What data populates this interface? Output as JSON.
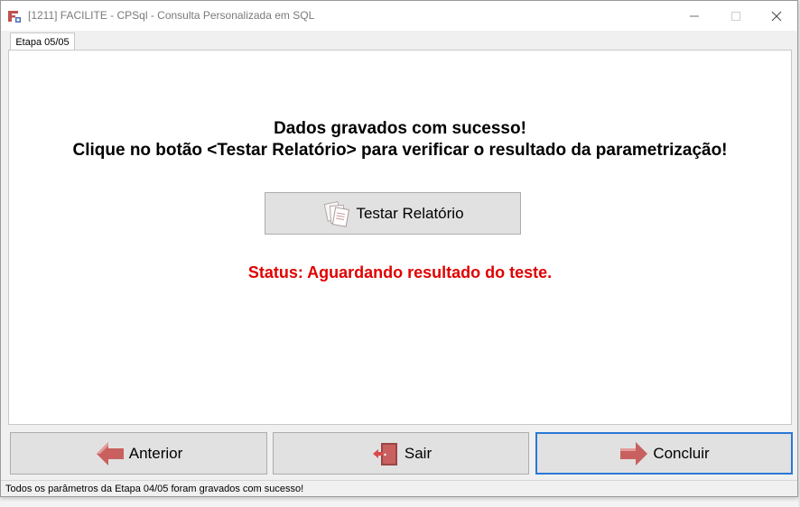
{
  "window": {
    "title": "[1211] FACILITE - CPSql - Consulta Personalizada em SQL"
  },
  "tabs": [
    {
      "label": "Etapa 05/05"
    }
  ],
  "main": {
    "message_line1": "Dados gravados com sucesso!",
    "message_line2": "Clique no botão <Testar Relatório> para verificar o resultado da parametrização!",
    "test_button_label": "Testar Relatório",
    "status_text": "Status: Aguardando resultado do teste."
  },
  "footer_buttons": {
    "previous_label": "Anterior",
    "exit_label": "Sair",
    "finish_label": "Concluir"
  },
  "statusbar": {
    "text": "Todos os parâmetros da Etapa 04/05 foram gravados com sucesso!"
  },
  "colors": {
    "status_text": "#e00000",
    "arrow_icon": "#c96060",
    "focus_border": "#2b78d4"
  },
  "icons": {
    "app": "app-icon",
    "test": "documents-icon",
    "previous": "arrow-left-icon",
    "exit": "exit-door-icon",
    "finish": "arrow-right-icon"
  }
}
